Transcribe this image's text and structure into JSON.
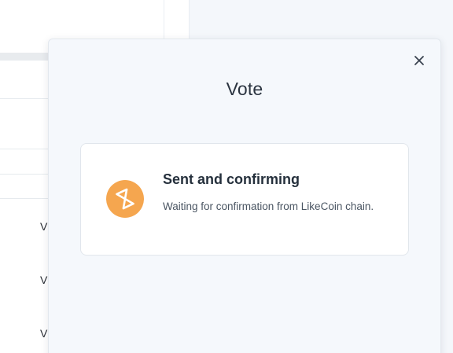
{
  "background": {
    "row_letters": [
      "V",
      "V",
      "V"
    ]
  },
  "modal": {
    "title": "Vote",
    "close_icon": "close-icon",
    "status": {
      "icon": "hourglass-icon",
      "icon_color": "#f5a64f",
      "title": "Sent and confirming",
      "description": "Waiting for confirmation from LikeCoin chain."
    }
  }
}
